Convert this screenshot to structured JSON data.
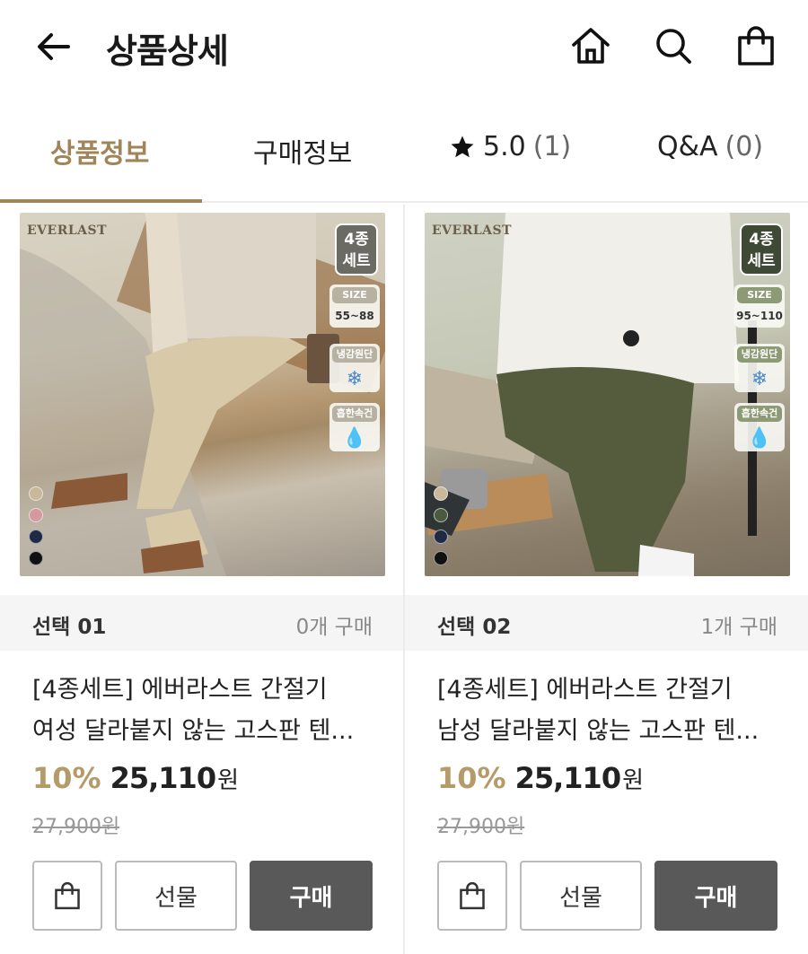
{
  "header": {
    "title": "상품상세",
    "icons": [
      "back-arrow-icon",
      "home-icon",
      "search-icon",
      "shopping-bag-icon"
    ]
  },
  "tabs": [
    {
      "label": "상품정보",
      "active": true
    },
    {
      "label": "구매정보",
      "active": false
    },
    {
      "label": "5.0",
      "count": "(1)",
      "icon": "star-icon",
      "active": false
    },
    {
      "label": "Q&A",
      "count": "(0)",
      "active": false
    }
  ],
  "colors": {
    "accent": "#a0845a",
    "discount": "#b59a6a",
    "buy_button": "#595959"
  },
  "products": [
    {
      "brand": "EVERLAST",
      "badge_set": [
        "4종",
        "세트"
      ],
      "size_label": "SIZE",
      "size_range": "55~88",
      "feature1": "냉감원단",
      "feature2": "흡한속건",
      "option_label": "선택 01",
      "purchase_count": "0개 구매",
      "name_line1": "[4종세트] 에버라스트 간절기",
      "name_line2": "여성 달라붙지 않는 고스판 텐...",
      "discount": "10%",
      "price": "25,110",
      "currency": "원",
      "original_price": "27,900원",
      "gift_label": "선물",
      "buy_label": "구매",
      "swatches": [
        "#c9b89a",
        "#d49aa0",
        "#1f2a44",
        "#111111"
      ]
    },
    {
      "brand": "EVERLAST",
      "badge_set": [
        "4종",
        "세트"
      ],
      "size_label": "SIZE",
      "size_range": "95~110",
      "feature1": "냉감원단",
      "feature2": "흡한속건",
      "option_label": "선택 02",
      "purchase_count": "1개 구매",
      "name_line1": "[4종세트] 에버라스트 간절기",
      "name_line2": "남성 달라붙지 않는 고스판 텐...",
      "discount": "10%",
      "price": "25,110",
      "currency": "원",
      "original_price": "27,900원",
      "gift_label": "선물",
      "buy_label": "구매",
      "swatches": [
        "#c9b89a",
        "#4b5a3c",
        "#1f2a44",
        "#111111"
      ]
    }
  ]
}
